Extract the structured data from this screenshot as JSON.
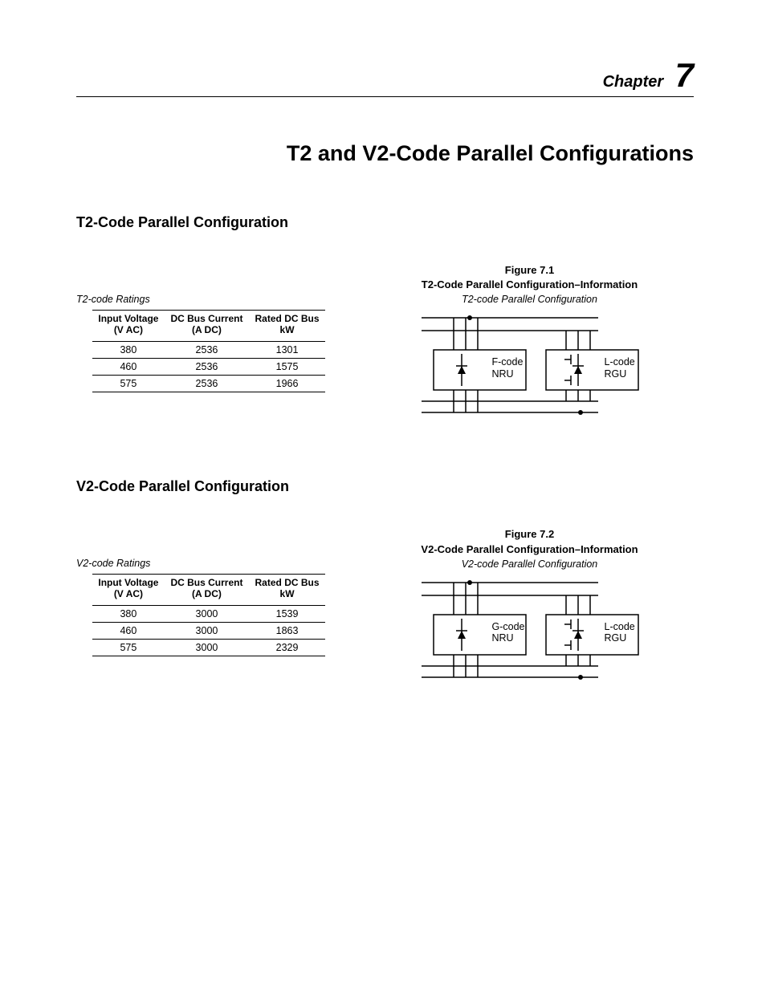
{
  "chapter": {
    "label": "Chapter",
    "number": "7",
    "title": "T2 and V2-Code Parallel Configurations"
  },
  "sections": {
    "t2": {
      "heading": "T2-Code Parallel Configuration",
      "figure_num": "Figure 7.1",
      "figure_title": "T2-Code Parallel Configuration–Information",
      "diagram_caption": "T2-code Parallel Configuration",
      "ratings_caption": "T2-code Ratings",
      "table": {
        "headers": {
          "col1_line1": "Input Voltage",
          "col1_line2": "(V AC)",
          "col2_line1": "DC Bus Current",
          "col2_line2": "(A DC)",
          "col3_line1": "Rated DC Bus",
          "col3_line2": "kW"
        },
        "rows": [
          {
            "c1": "380",
            "c2": "2536",
            "c3": "1301"
          },
          {
            "c1": "460",
            "c2": "2536",
            "c3": "1575"
          },
          {
            "c1": "575",
            "c2": "2536",
            "c3": "1966"
          }
        ]
      },
      "box_left": {
        "line1": "F-code",
        "line2": "NRU"
      },
      "box_right": {
        "line1": "L-code",
        "line2": "RGU"
      }
    },
    "v2": {
      "heading": "V2-Code Parallel Configuration",
      "figure_num": "Figure 7.2",
      "figure_title": "V2-Code Parallel Configuration–Information",
      "diagram_caption": "V2-code Parallel Configuration",
      "ratings_caption": "V2-code Ratings",
      "table": {
        "headers": {
          "col1_line1": "Input Voltage",
          "col1_line2": "(V AC)",
          "col2_line1": "DC Bus Current",
          "col2_line2": "(A DC)",
          "col3_line1": "Rated DC Bus",
          "col3_line2": "kW"
        },
        "rows": [
          {
            "c1": "380",
            "c2": "3000",
            "c3": "1539"
          },
          {
            "c1": "460",
            "c2": "3000",
            "c3": "1863"
          },
          {
            "c1": "575",
            "c2": "3000",
            "c3": "2329"
          }
        ]
      },
      "box_left": {
        "line1": "G-code",
        "line2": "NRU"
      },
      "box_right": {
        "line1": "L-code",
        "line2": "RGU"
      }
    }
  }
}
